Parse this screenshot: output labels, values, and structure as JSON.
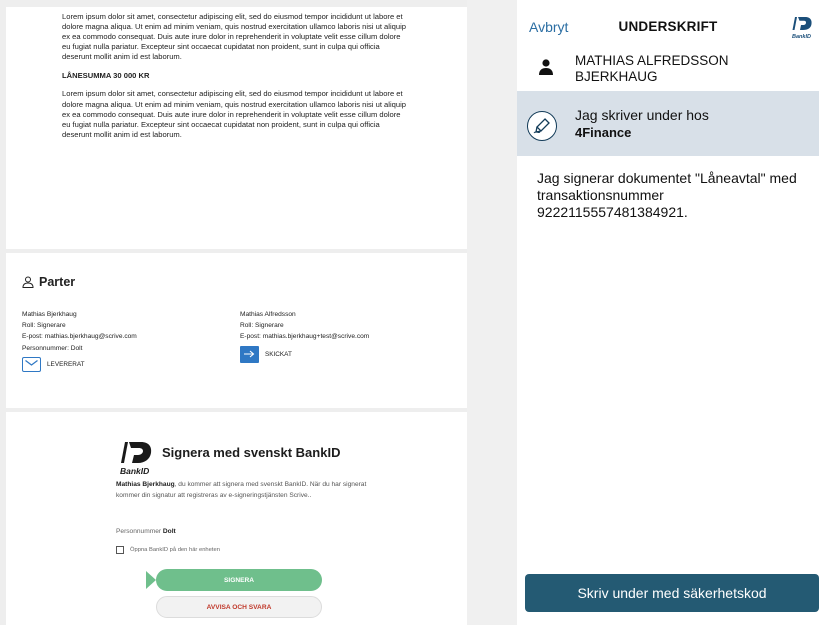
{
  "document": {
    "paragraph1": "Lorem ipsum dolor sit amet, consectetur adipiscing elit, sed do eiusmod tempor incididunt ut labore et dolore magna aliqua. Ut enim ad minim veniam, quis nostrud exercitation ullamco laboris nisi ut aliquip ex ea commodo consequat. Duis aute irure dolor in reprehenderit in voluptate velit esse cillum dolore eu fugiat nulla pariatur. Excepteur sint occaecat cupidatat non proident, sunt in culpa qui officia deserunt mollit anim id est laborum.",
    "loan_heading": "LÅNESUMMA 30 000 KR",
    "paragraph2": "Lorem ipsum dolor sit amet, consectetur adipiscing elit, sed do eiusmod tempor incididunt ut labore et dolore magna aliqua. Ut enim ad minim veniam, quis nostrud exercitation ullamco laboris nisi ut aliquip ex ea commodo consequat. Duis aute irure dolor in reprehenderit in voluptate velit esse cillum dolore eu fugiat nulla pariatur. Excepteur sint occaecat cupidatat non proident, sunt in culpa qui officia deserunt mollit anim id est laborum."
  },
  "parties": {
    "title": "Parter",
    "icon": "person-outline-icon",
    "list": [
      {
        "name": "Mathias Bjerkhaug",
        "role": "Roll:  Signerare",
        "email": "E-post:  mathias.bjerkhaug@scrive.com",
        "pnr": "Personnummer:  Dolt",
        "status": "LEVERERAT",
        "status_icon": "envelope-icon"
      },
      {
        "name": "Mathias Alfredsson",
        "role": "Roll:  Signerare",
        "email": "E-post:  mathias.bjerkhaug+test@scrive.com",
        "status": "SKICKAT",
        "status_icon": "arrow-right-icon"
      }
    ]
  },
  "signing": {
    "title": "Signera med svenskt BankID",
    "logo_text": "BankID",
    "name_bold": "Mathias Bjerkhaug",
    "text": ", du kommer att signera med svenskt BankID. När du har signerat kommer din signatur att registreras av e-signeringstjänsten Scrive..",
    "pnr_label": "Personnummer",
    "pnr_value": "Dolt",
    "checkbox_label": "Öppna BankID på den här enheten",
    "sign_button": "SIGNERA",
    "reject_button": "AVVISA OCH SVARA",
    "sign_color": "#6fbf8c",
    "reject_color": "#c0392b"
  },
  "bankid": {
    "cancel": "Avbryt",
    "title": "UNDERSKRIFT",
    "logo_text": "BankID",
    "user_name_line1": "MATHIAS ALFREDSSON",
    "user_name_line2": "BJERKHAUG",
    "signer_line1": "Jag skriver under hos",
    "signer_line2": "4Finance",
    "message": "Jag signerar dokumentet \"Låneavtal\" med transaktionsnummer 9222115557481384921.",
    "button": "Skriv under med säkerhetskod",
    "accent": "#245a73",
    "link_color": "#2b6ea3"
  }
}
